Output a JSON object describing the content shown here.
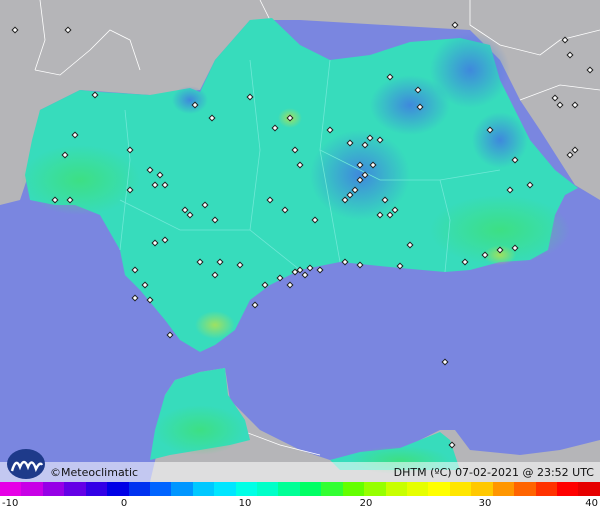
{
  "map": {
    "region": "Andalucía",
    "colors": {
      "sea": "#7a86e0",
      "land_outside": "#b5b5b8",
      "region_base": "#37dcbc",
      "region_blue": "#4aa8e6",
      "region_green": "#3fd88a",
      "station": "#222222"
    }
  },
  "footer": {
    "attribution": "©Meteoclimatic",
    "legend_title": "DHTM (ºC) 07-02-2021 @ 23:52 UTC"
  },
  "scale": {
    "ticks": [
      "-10",
      "0",
      "10",
      "20",
      "30",
      "40"
    ],
    "min": -10,
    "max": 40
  }
}
